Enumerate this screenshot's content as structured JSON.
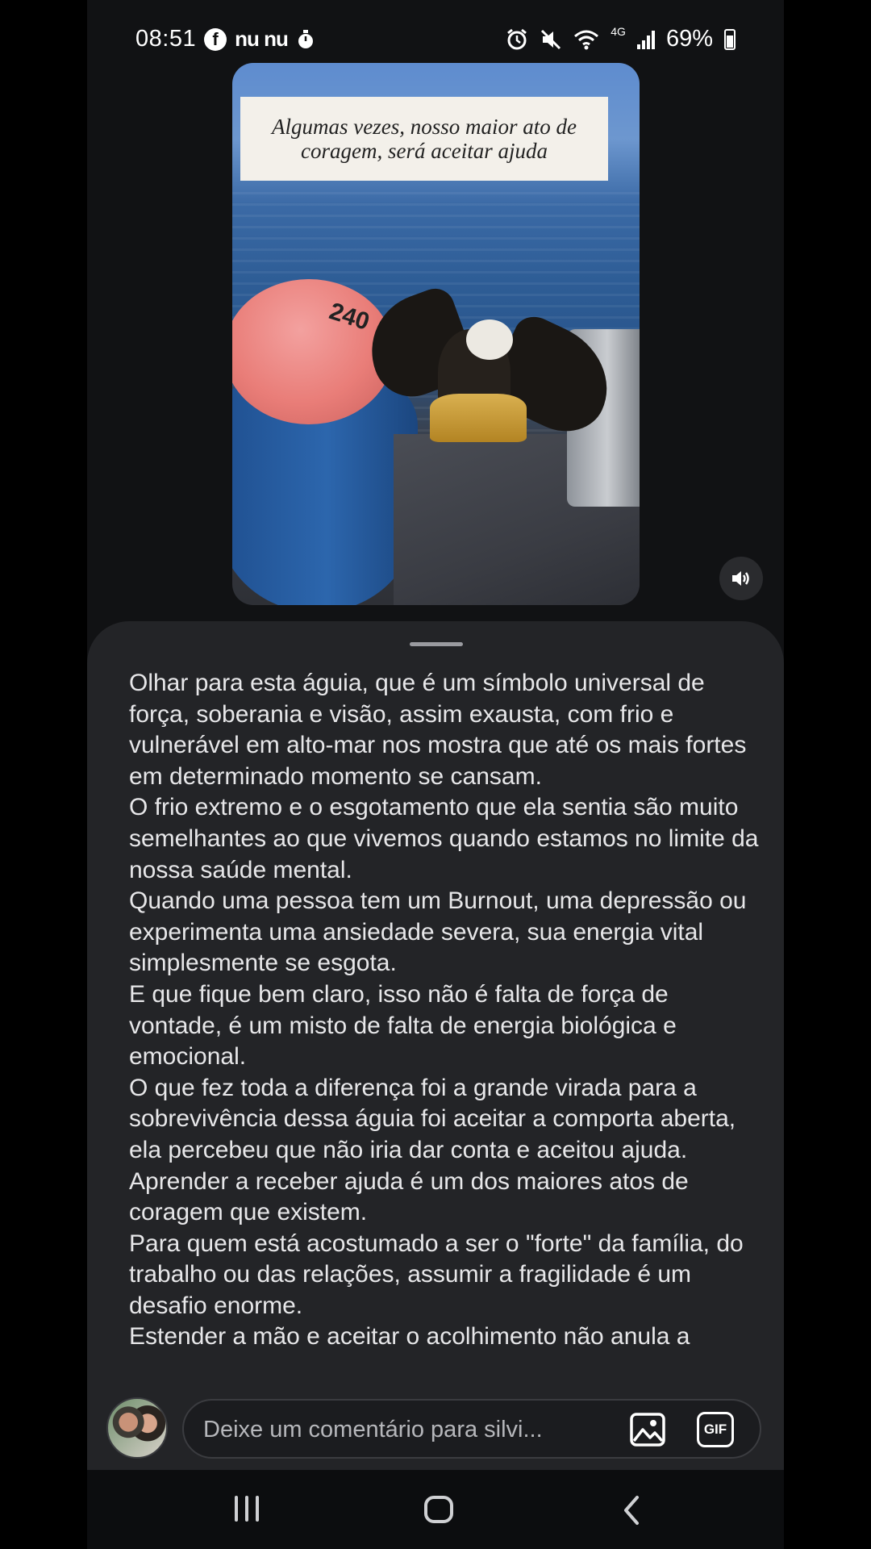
{
  "status_bar": {
    "time": "08:51",
    "app_label": "nu nu",
    "network": "4G",
    "battery": "69%",
    "icons": [
      "facebook-icon",
      "stopwatch-icon",
      "alarm-icon",
      "mute-icon",
      "wifi-icon",
      "signal-icon",
      "battery-icon"
    ]
  },
  "video": {
    "caption": "Algumas vezes, nosso maior ato de coragem, será aceitar ajuda",
    "buoy_text": "240",
    "volume_icon": "volume-icon"
  },
  "post": {
    "paragraphs": [
      "Olhar para esta águia, que é um símbolo universal de força, soberania e visão, assim exausta, com frio e vulnerável em alto-mar nos mostra que até os mais fortes em determinado momento se cansam.",
      "O frio extremo e o esgotamento que ela sentia são muito semelhantes ao que vivemos quando estamos no limite da nossa saúde mental.",
      "Quando uma pessoa tem um Burnout,  uma depressão ou experimenta uma ansiedade severa, sua energia vital simplesmente se esgota.",
      "E que fique bem claro, isso não é falta de força de vontade, é um misto de falta de energia biológica e emocional.",
      "O que fez toda a diferença foi a grande virada para a sobrevivência dessa águia foi aceitar a comporta aberta, ela percebeu que não iria dar conta e aceitou ajuda.",
      "Aprender a receber ajuda é um dos maiores atos de coragem que existem.",
      "Para quem está acostumado a ser o \"forte\" da família, do trabalho ou das relações, assumir a fragilidade é um desafio enorme.",
      "Estender a mão e aceitar o acolhimento não anula a"
    ]
  },
  "comment_bar": {
    "placeholder": "Deixe um comentário para silvi...",
    "gif_label": "GIF"
  },
  "colors": {
    "background": "#111214",
    "sheet": "#232427",
    "text": "#e7e7e9"
  }
}
